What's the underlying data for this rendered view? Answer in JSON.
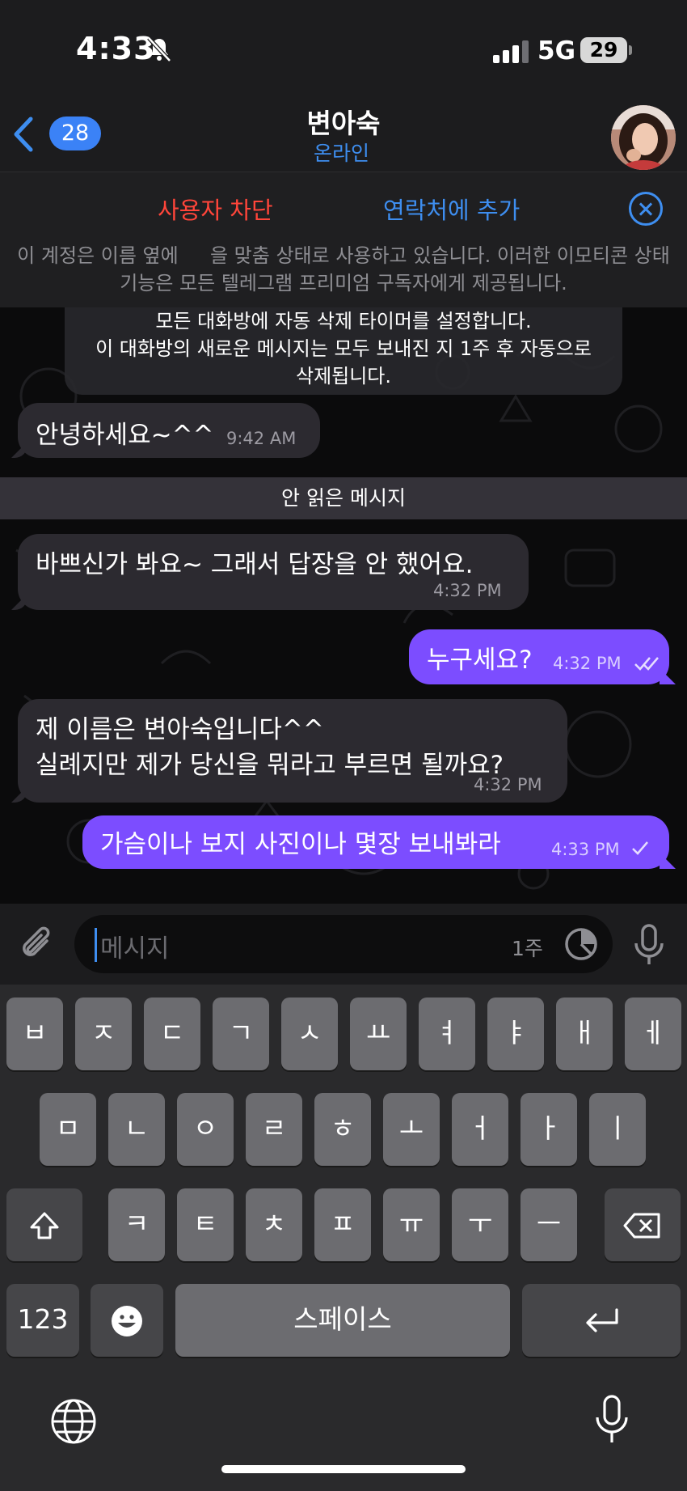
{
  "status_bar": {
    "time": "4:33",
    "network": "5G",
    "battery": "29"
  },
  "nav": {
    "back_count": "28",
    "chat_name": "변아숙",
    "chat_status": "온라인"
  },
  "banner": {
    "block_user": "사용자 차단",
    "add_contact": "연락처에 추가",
    "note": "이 계정은 이름 옆에 　 을 맞춤 상태로 사용하고 있습니다. 이러한 이모티콘 상태 기능은 모든 텔레그램 프리미엄 구독자에게 제공됩니다."
  },
  "chat": {
    "service_line1": "모든 대화방에 자동 삭제 타이머를 설정합니다.",
    "service_line2": "이 대화방의 새로운 메시지는 모두 보내진 지 1주 후 자동으로",
    "service_line3": "삭제됩니다.",
    "unread_separator": "안 읽은 메시지",
    "messages": [
      {
        "direction": "in",
        "text": "안녕하세요~^^",
        "time": "9:42 AM"
      },
      {
        "direction": "in",
        "text": "바쁘신가 봐요~ 그래서 답장을 안 했어요.",
        "time": "4:32 PM"
      },
      {
        "direction": "out",
        "text": "누구세요?",
        "time": "4:32 PM",
        "status": "read"
      },
      {
        "direction": "in",
        "line1": "제 이름은 변아숙입니다^^",
        "line2": "실례지만 제가 당신을 뭐라고 부르면 될까요?",
        "time": "4:32 PM"
      },
      {
        "direction": "out",
        "text": "가슴이나 보지 사진이나 몇장 보내봐라",
        "time": "4:33 PM",
        "status": "sent"
      }
    ]
  },
  "input": {
    "placeholder": "메시지",
    "timer_label": "1주"
  },
  "keyboard": {
    "row1": [
      "ㅂ",
      "ㅈ",
      "ㄷ",
      "ㄱ",
      "ㅅ",
      "ㅛ",
      "ㅕ",
      "ㅑ",
      "ㅐ",
      "ㅔ"
    ],
    "row2": [
      "ㅁ",
      "ㄴ",
      "ㅇ",
      "ㄹ",
      "ㅎ",
      "ㅗ",
      "ㅓ",
      "ㅏ",
      "ㅣ"
    ],
    "row3": [
      "ㅋ",
      "ㅌ",
      "ㅊ",
      "ㅍ",
      "ㅠ",
      "ㅜ",
      "ㅡ"
    ],
    "numbers_key": "123",
    "space_key": "스페이스"
  },
  "icons": {
    "back": "chevron-left-icon",
    "mute": "bell-slash-icon",
    "close": "close-icon",
    "attach": "paperclip-icon",
    "timer": "timer-icon",
    "mic": "microphone-icon",
    "shift": "shift-icon",
    "delete": "backspace-icon",
    "emoji": "emoji-icon",
    "return": "return-icon",
    "globe": "globe-icon"
  },
  "colors": {
    "accent": "#3e8ef0",
    "danger": "#ff453a",
    "outgoing_bubble": "#7c4dff",
    "incoming_bubble": "#2c2a30"
  }
}
